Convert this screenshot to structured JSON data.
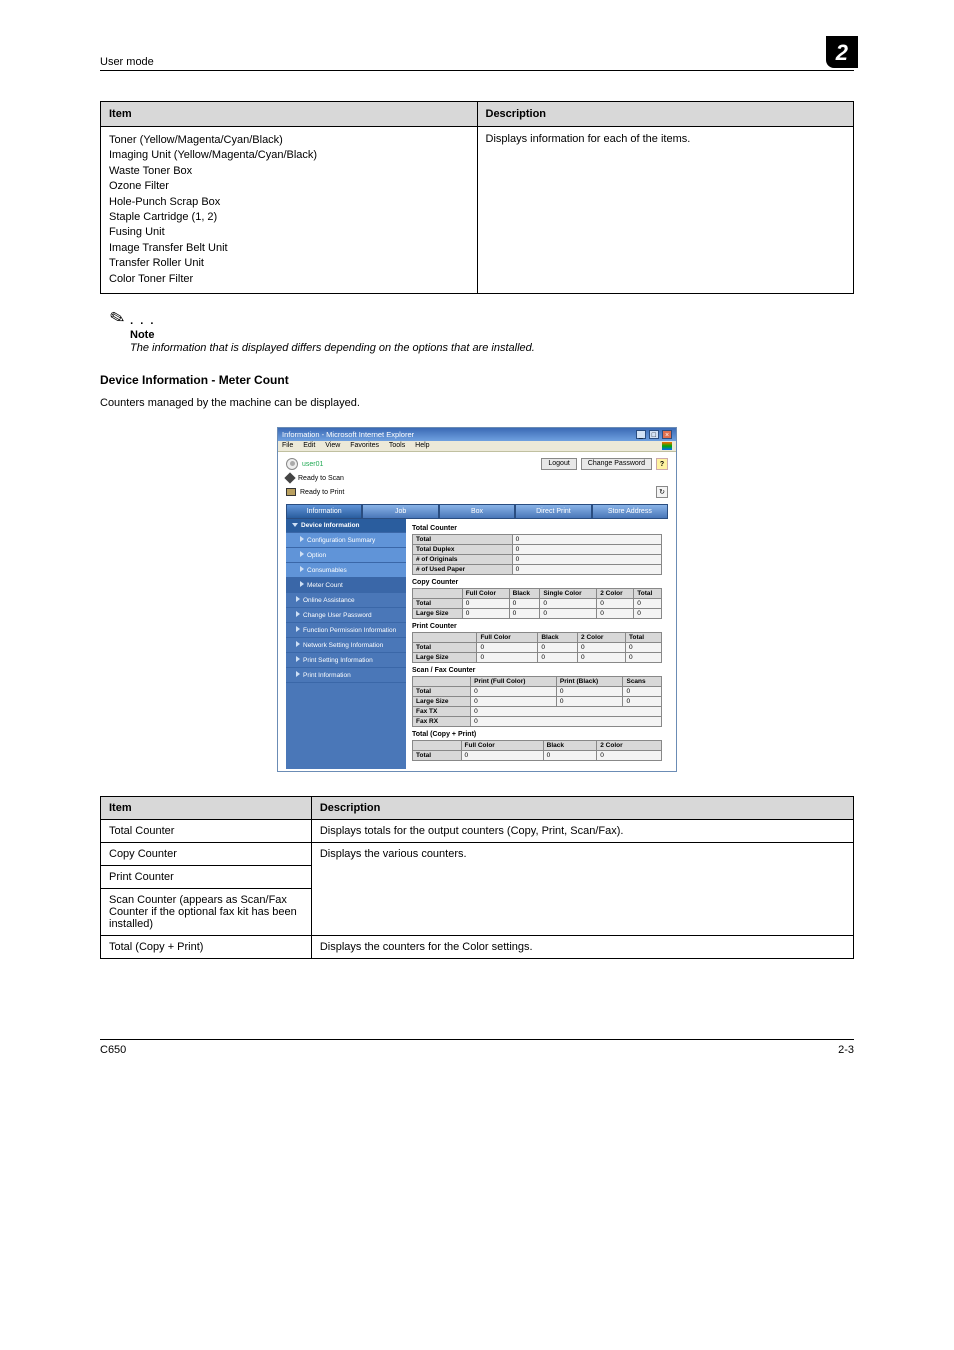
{
  "header": {
    "left": "User mode",
    "page_badge": "2"
  },
  "table_top": {
    "headers": {
      "item": "Item",
      "desc": "Description"
    },
    "items": [
      "Toner (Yellow/Magenta/Cyan/Black)",
      "Imaging Unit (Yellow/Magenta/Cyan/Black)",
      "Waste Toner Box",
      "Ozone Filter",
      "Hole-Punch Scrap Box",
      "Staple Cartridge (1, 2)",
      "Fusing Unit",
      "Image Transfer Belt Unit",
      "Transfer Roller Unit",
      "Color Toner Filter"
    ],
    "desc": "Displays information for each of the items."
  },
  "note": {
    "title": "Note",
    "body": "The information that is displayed differs depending on the options that are installed."
  },
  "section": {
    "title": "Device Information - Meter Count",
    "body": "Counters managed by the machine can be displayed."
  },
  "browser": {
    "window_title": "Information - Microsoft Internet Explorer",
    "menu": [
      "File",
      "Edit",
      "View",
      "Favorites",
      "Tools",
      "Help"
    ],
    "user": "user01",
    "buttons": {
      "logout": "Logout",
      "changepw": "Change Password"
    },
    "status_scan": "Ready to Scan",
    "status_print": "Ready to Print",
    "tabs": [
      "Information",
      "Job",
      "Box",
      "Direct Print",
      "Store Address"
    ],
    "side": {
      "head": "Device Information",
      "items_sub": [
        "Configuration Summary",
        "Option",
        "Consumables",
        "Meter Count"
      ],
      "items_lvl": [
        "Online Assistance",
        "Change User Password",
        "Function Permission Information",
        "Network Setting Information",
        "Print Setting Information",
        "Print Information"
      ]
    },
    "content": {
      "total_counter": {
        "title": "Total Counter",
        "rows": [
          {
            "label": "Total",
            "val": "0"
          },
          {
            "label": "Total Duplex",
            "val": "0"
          },
          {
            "label": "# of Originals",
            "val": "0"
          },
          {
            "label": "# of Used Paper",
            "val": "0"
          }
        ]
      },
      "copy_counter": {
        "title": "Copy Counter",
        "headers": [
          "",
          "Full Color",
          "Black",
          "Single Color",
          "2 Color",
          "Total"
        ],
        "rows": [
          [
            "Total",
            "0",
            "0",
            "0",
            "0",
            "0"
          ],
          [
            "Large Size",
            "0",
            "0",
            "0",
            "0",
            "0"
          ]
        ]
      },
      "print_counter": {
        "title": "Print Counter",
        "headers": [
          "",
          "Full Color",
          "Black",
          "2 Color",
          "Total"
        ],
        "rows": [
          [
            "Total",
            "0",
            "0",
            "0",
            "0"
          ],
          [
            "Large Size",
            "0",
            "0",
            "0",
            "0"
          ]
        ]
      },
      "scanfax_counter": {
        "title": "Scan / Fax Counter",
        "headers": [
          "",
          "Print (Full Color)",
          "Print (Black)",
          "Scans"
        ],
        "rows": [
          [
            "Total",
            "0",
            "0",
            "0"
          ],
          [
            "Large Size",
            "0",
            "0",
            "0"
          ]
        ],
        "extra": [
          [
            "Fax TX",
            "0"
          ],
          [
            "Fax RX",
            "0"
          ]
        ]
      },
      "total_cp": {
        "title": "Total (Copy + Print)",
        "headers": [
          "",
          "Full Color",
          "Black",
          "2 Color"
        ],
        "rows": [
          [
            "Total",
            "0",
            "0",
            "0"
          ]
        ]
      }
    }
  },
  "table_bottom": {
    "headers": {
      "item": "Item",
      "desc": "Description"
    },
    "rows": [
      {
        "item": "Total Counter",
        "desc": "Displays totals for the output counters (Copy, Print, Scan/Fax)."
      },
      {
        "item": "Copy Counter",
        "desc": "Displays the various counters.",
        "rowspan_start": true
      },
      {
        "item": "Print Counter",
        "desc": "",
        "rowspan_cont": true
      },
      {
        "item": "Scan Counter (appears as Scan/Fax Counter if the optional fax kit has been installed)",
        "desc": "",
        "rowspan_cont": true
      },
      {
        "item": "Total (Copy + Print)",
        "desc": "Displays the counters for the Color settings."
      }
    ]
  },
  "footer": {
    "left": "C650",
    "right": "2-3"
  }
}
